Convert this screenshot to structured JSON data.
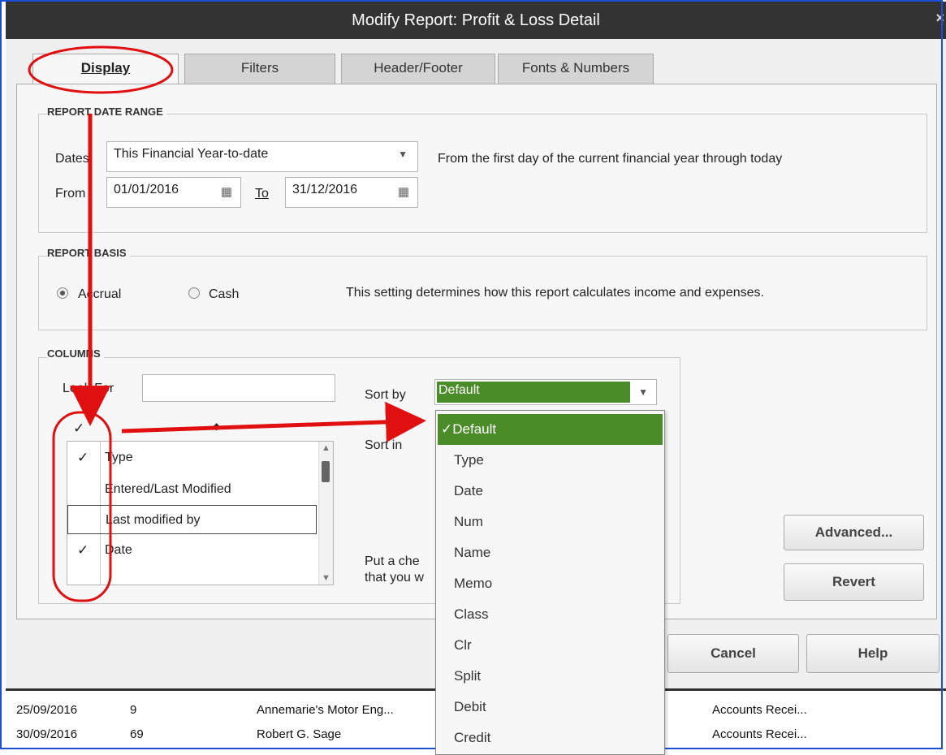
{
  "window": {
    "title": "Modify Report: Profit & Loss Detail",
    "close_glyph": "×"
  },
  "tabs": [
    {
      "label": "Display",
      "active": true
    },
    {
      "label": "Filters"
    },
    {
      "label": "Header/Footer"
    },
    {
      "label": "Fonts & Numbers"
    }
  ],
  "date_range": {
    "section": "REPORT DATE RANGE",
    "dates_label": "Dates",
    "dates_value": "This Financial Year-to-date",
    "description": "From the first day of the current financial year through today",
    "from_label": "From",
    "from_value": "01/01/2016",
    "to_label": "To",
    "to_value": "31/12/2016"
  },
  "basis": {
    "section": "REPORT BASIS",
    "accrual_label": "Accrual",
    "cash_label": "Cash",
    "description": "This setting determines how this report calculates income and expenses.",
    "selected": "Accrual"
  },
  "columns": {
    "section": "COLUMNS",
    "look_for_label": "Look For",
    "look_for_value": "",
    "header_check": "✓",
    "sort_by_label": "Sort by",
    "sort_by_value": "Default",
    "sort_in_label": "Sort in",
    "put_check_text_1": "Put a che",
    "put_check_text_2": "that you w",
    "items": [
      {
        "check": "✓",
        "label": "Type"
      },
      {
        "check": "",
        "label": "Entered/Last Modified"
      },
      {
        "check": "",
        "label": "Last modified by"
      },
      {
        "check": "✓",
        "label": "Date"
      }
    ]
  },
  "sort_options": [
    "✓Default",
    "Type",
    "Date",
    "Num",
    "Name",
    "Memo",
    "Class",
    "Clr",
    "Split",
    "Debit",
    "Credit"
  ],
  "buttons": {
    "advanced": "Advanced...",
    "revert": "Revert",
    "cancel": "Cancel",
    "help": "Help"
  },
  "background_rows": [
    [
      "25/09/2016",
      "9",
      "Annemarie's Motor Eng...",
      "Accounts Recei..."
    ],
    [
      "30/09/2016",
      "69",
      "Robert G. Sage",
      "Accounts Recei..."
    ]
  ],
  "colors": {
    "accent_green": "#4a8c28",
    "annotation_red": "#e01010",
    "titlebar": "#333333"
  }
}
